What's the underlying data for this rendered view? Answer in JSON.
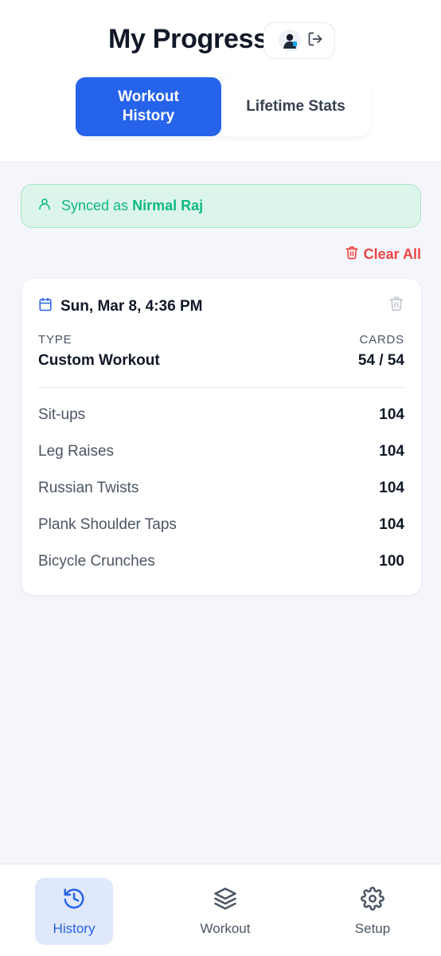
{
  "header": {
    "title": "My Progress",
    "tabs": [
      {
        "label": "Workout\nHistory",
        "active": true
      },
      {
        "label": "Lifetime Stats",
        "active": false
      }
    ]
  },
  "sync": {
    "prefix": "Synced as",
    "user": "Nirmal Raj"
  },
  "actions": {
    "clear_all": "Clear All"
  },
  "workout": {
    "date": "Sun, Mar 8, 4:36 PM",
    "type_label": "TYPE",
    "type_value": "Custom Workout",
    "cards_label": "CARDS",
    "cards_value": "54 / 54",
    "exercises": [
      {
        "name": "Sit-ups",
        "count": "104"
      },
      {
        "name": "Leg Raises",
        "count": "104"
      },
      {
        "name": "Russian Twists",
        "count": "104"
      },
      {
        "name": "Plank Shoulder Taps",
        "count": "104"
      },
      {
        "name": "Bicycle Crunches",
        "count": "100"
      }
    ]
  },
  "nav": {
    "items": [
      {
        "label": "History",
        "icon": "history-icon",
        "active": true
      },
      {
        "label": "Workout",
        "icon": "layers-icon",
        "active": false
      },
      {
        "label": "Setup",
        "icon": "gear-icon",
        "active": false
      }
    ]
  },
  "colors": {
    "accent": "#2563eb",
    "success": "#10b981",
    "danger": "#ef4444"
  }
}
